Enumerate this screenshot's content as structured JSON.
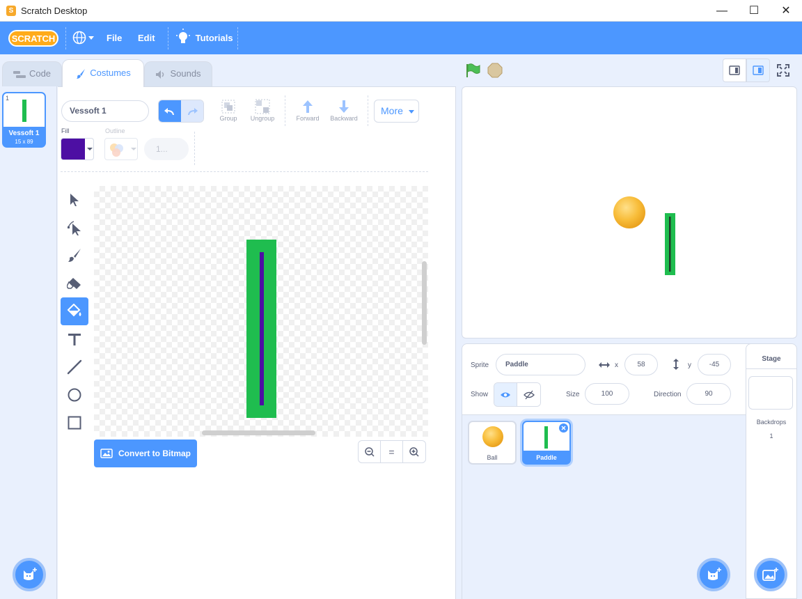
{
  "window": {
    "title": "Scratch Desktop",
    "minimize": "—",
    "maximize": "☐",
    "close": "✕"
  },
  "menu": {
    "logo": "SCRATCH",
    "file": "File",
    "edit": "Edit",
    "tutorials": "Tutorials"
  },
  "tabs": {
    "code": "Code",
    "costumes": "Costumes",
    "sounds": "Sounds"
  },
  "costume_list": {
    "number": "1",
    "name": "Vessoft 1",
    "size": "15 x 89"
  },
  "paint": {
    "costume_name": "Vessoft 1",
    "group": "Group",
    "ungroup": "Ungroup",
    "forward": "Forward",
    "backward": "Backward",
    "more": "More",
    "fill_label": "Fill",
    "outline_label": "Outline",
    "outline_width": "1...",
    "fill_color": "#4d0fa3",
    "convert": "Convert to Bitmap",
    "zoom_reset": "="
  },
  "sprite_info": {
    "sprite_label": "Sprite",
    "sprite_name": "Paddle",
    "x_label": "x",
    "x_value": "58",
    "y_label": "y",
    "y_value": "-45",
    "show_label": "Show",
    "size_label": "Size",
    "size_value": "100",
    "direction_label": "Direction",
    "direction_value": "90"
  },
  "sprites": [
    {
      "name": "Ball"
    },
    {
      "name": "Paddle"
    }
  ],
  "stage_panel": {
    "title": "Stage",
    "backdrops_label": "Backdrops",
    "backdrops_count": "1"
  },
  "colors": {
    "accent": "#4c97ff",
    "paddle_green": "#1fbd4f",
    "ball_orange": "#f5b937"
  }
}
